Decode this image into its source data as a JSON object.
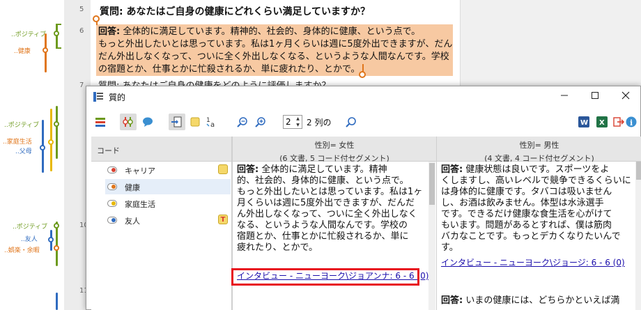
{
  "background_doc": {
    "line_numbers": [
      "5",
      "6",
      "7",
      "10",
      "11"
    ],
    "question": "質問: あなたはご自身の健康にどれくらい満足していますか？",
    "answer_prefix": "回答:",
    "answer_lines": [
      " 全体的に満足しています。精神的、社会的、身体的に健康、という点で。",
      "もっと外出したいとは思っています。私は1ヶ月くらいは週に5度外出できますが、だん",
      "だん外出しなくなって、ついに全く外出しなくなる、というような人間なんです。学校",
      "の宿題とか、仕事とかに忙殺されるか、単に疲れたり、とかで。"
    ],
    "next_line": "質問: あなたはご自身の健康をどのように評価しますか？"
  },
  "coding_stripes": [
    {
      "label": "..ポジティブ",
      "color": "#6d9a1e"
    },
    {
      "label": "..健康",
      "color": "#e0761c"
    },
    {
      "label": "..ポジティブ",
      "color": "#6d9a1e"
    },
    {
      "label": "..家庭生活",
      "color": "#e8b800"
    },
    {
      "label": "..父母",
      "color": "#2f6bbf"
    },
    {
      "label": "..ポジティブ",
      "color": "#6d9a1e"
    },
    {
      "label": "..友人",
      "color": "#2f6bbf"
    },
    {
      "label": "..娯楽・余暇",
      "color": "#e0761c"
    }
  ],
  "dialog": {
    "title": "質的",
    "toolbar": {
      "columns_value": "2",
      "columns_label": "2 列の"
    },
    "code_header": "コード",
    "codes": [
      {
        "label": "キャリア",
        "dot": "#d94030",
        "badge": "",
        "badge_color": "#f5d86a"
      },
      {
        "label": "健康",
        "dot": "#e0761c",
        "badge": "",
        "badge_color": ""
      },
      {
        "label": "家庭生活",
        "dot": "#e8b800",
        "badge": "",
        "badge_color": ""
      },
      {
        "label": "友人",
        "dot": "#2f6bbf",
        "badge": "T",
        "badge_color": "#f5d86a"
      }
    ],
    "columns": [
      {
        "header_line1": "性別= 女性",
        "header_line2": "(6 文書, 5 コード付セグメント)",
        "segment_prefix": "回答:",
        "segment_lines": [
          " 全体的に満足しています。精神",
          "的、社会的、身体的に健康、という点で。",
          "もっと外出したいとは思っています。私は1ヶ",
          "月くらいは週に5度外出できますが、だんだ",
          "ん外出しなくなって、ついに全く外出しなく",
          "なる、というような人間なんです。学校の",
          "宿題とか、仕事とかに忙殺されるか、単に",
          "疲れたり、とかで。"
        ],
        "link": "インタビュー - ニューヨーク\\ジョアンナ: 6 - 6 (0)"
      },
      {
        "header_line1": "性別= 男性",
        "header_line2": "(4 文書, 4 コード付セグメント)",
        "segment_prefix": "回答:",
        "segment_lines": [
          " 健康状態は良いです。スポーツをよ",
          "くしますし、高いレベルで競争できるくらいに",
          "は身体的に健康です。タバコは吸いません",
          "し、お酒は飲みません。体型は水泳選手",
          "です。できるだけ健康な食生活を心がけて",
          "もいます。問題があるとすれば、僕は筋肉",
          "バカなことです。もっとデカくなりたいんです。"
        ],
        "link": "インタビュー - ニューヨーク\\ジョージ: 6 - 6 (0)",
        "segment2_prefix": "回答:",
        "segment2_line": " いまの健康には、どちらかといえば満"
      }
    ]
  }
}
